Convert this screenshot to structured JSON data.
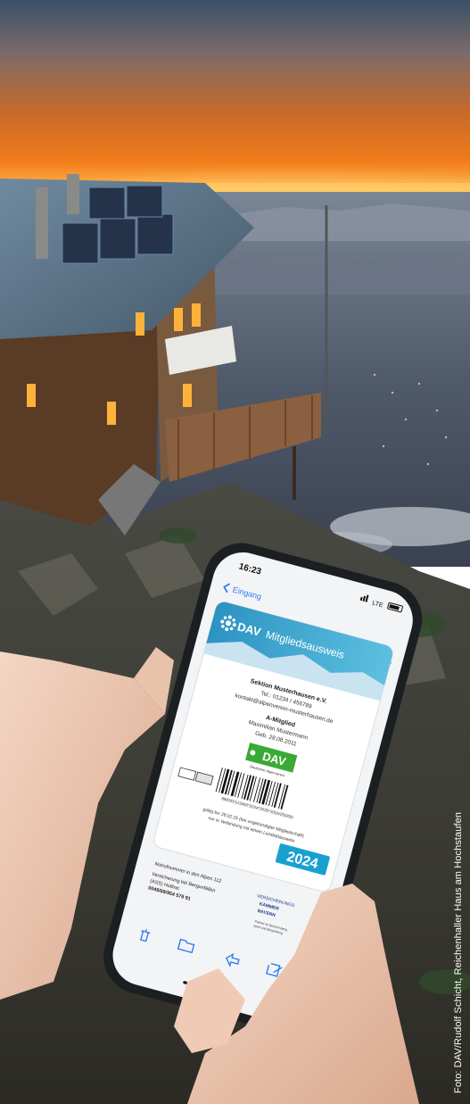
{
  "phone": {
    "time": "16:23",
    "back_label": "Eingang",
    "status": "LTE"
  },
  "card": {
    "brand": "DAV",
    "title": "Mitgliedsausweis",
    "section_name": "Sektion Musterhausen e.V.",
    "phone": "Tel.: 01234 / 456789",
    "email": "kontakt@alpenverein-musterhausen.de",
    "member_type": "A-Mitglied",
    "member_name": "Maximilian Mustermann",
    "birth_date": "Geb. 28.08.2011",
    "logo_text": "DAV",
    "logo_sub": "Deutscher Alpenverein",
    "barcode_number": "888/00/123456*2024*2025*2026/250830",
    "validity_line1": "gültig bis 28.02.25 (bei ungekündigter Mitgliedschaft)",
    "validity_line2": "nur in Verbindung mit einem Lichtbildausweis",
    "year": "2024"
  },
  "email_body": {
    "emergency_line": "Notrufnummer in den Alpen 112",
    "insurance_line1": "Versicherung bei Bergunfällen",
    "insurance_line2": "(ASS) Hotline:",
    "insurance_line3": "0049/89/954 578 91",
    "partner_line1": "VERSICHERUNGS",
    "partner_line2": "KAMMER",
    "partner_line3": "BAYERN",
    "partner_note1": "Partner im Bereich Berg-",
    "partner_note2": "sport und Bergrettung"
  },
  "credit": "Foto: DAV/Rudolf Schicht, Reichenhaller Haus am Hochstaufen",
  "colors": {
    "sky_top": "#2e4a6b",
    "sunset_glow": "#f0741a",
    "dav_green": "#3aa935",
    "card_header_blue": "#3aa3c9",
    "badge_blue": "#1aa0d0",
    "phone_frame": "#1c1f22",
    "ios_blue": "#2f7bf5"
  },
  "icons": [
    "back-chevron-icon",
    "signal-icon",
    "battery-icon",
    "up-chevron-icon",
    "down-chevron-icon",
    "edelweiss-icon",
    "trash-icon",
    "folder-icon",
    "reply-icon",
    "compose-icon"
  ]
}
